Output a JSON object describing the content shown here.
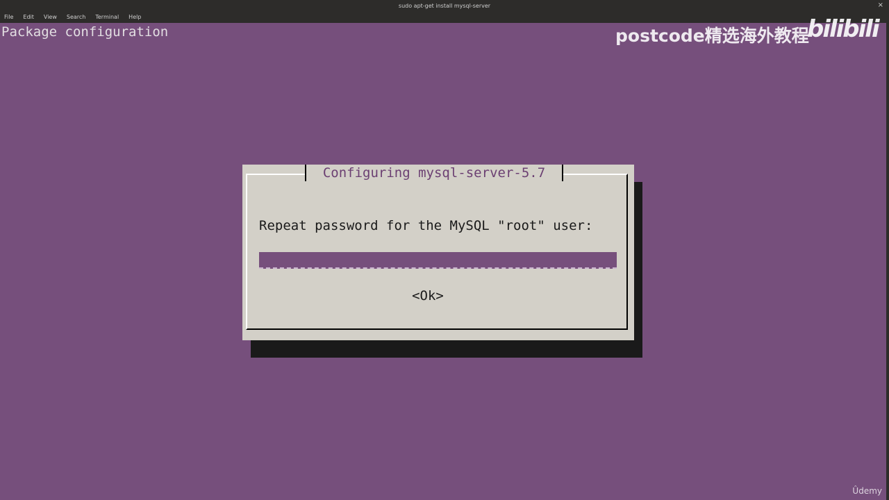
{
  "window": {
    "title": "sudo apt-get install mysql-server",
    "close_glyph": "×",
    "menu": [
      "File",
      "Edit",
      "View",
      "Search",
      "Terminal",
      "Help"
    ]
  },
  "terminal": {
    "header": "Package configuration"
  },
  "watermark": {
    "text": "postcode精选海外教程",
    "logo": "bilibili"
  },
  "dialog": {
    "title": " Configuring mysql-server-5.7 ",
    "prompt": "Repeat password for the MySQL \"root\" user:",
    "password_value": "",
    "ok_label": "<Ok>"
  },
  "footer": {
    "brand": "Ûdemy"
  },
  "colors": {
    "background": "#764f7c",
    "dialog_bg": "#d3d0c8",
    "title_text": "#6b3f72",
    "shadow": "#1a1a1a"
  }
}
